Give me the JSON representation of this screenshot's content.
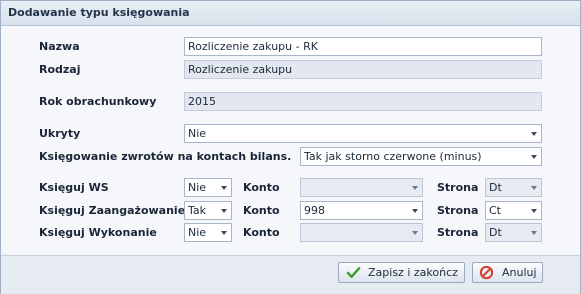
{
  "window": {
    "title": "Dodawanie typu księgowania"
  },
  "form": {
    "nazwa": {
      "label": "Nazwa",
      "value": "Rozliczenie zakupu - RK"
    },
    "rodzaj": {
      "label": "Rodzaj",
      "value": "Rozliczenie zakupu"
    },
    "rok": {
      "label": "Rok obrachunkowy",
      "value": "2015"
    },
    "ukryty": {
      "label": "Ukryty",
      "value": "Nie"
    },
    "zwroty": {
      "label": "Księgowanie zwrotów na kontach bilans.",
      "value": "Tak jak storno czerwone (minus)"
    },
    "rows": [
      {
        "label": "Księguj WS",
        "toggle": "Nie",
        "konto_label": "Konto",
        "konto": "",
        "strona_label": "Strona",
        "strona": "Dt"
      },
      {
        "label": "Księguj Zaangażowanie",
        "toggle": "Tak",
        "konto_label": "Konto",
        "konto": "998",
        "strona_label": "Strona",
        "strona": "Ct"
      },
      {
        "label": "Księguj Wykonanie",
        "toggle": "Nie",
        "konto_label": "Konto",
        "konto": "",
        "strona_label": "Strona",
        "strona": "Dt"
      }
    ]
  },
  "buttons": {
    "save": {
      "label": "Zapisz i zakończ",
      "icon": "check-icon"
    },
    "cancel": {
      "label": "Anuluj",
      "icon": "cancel-icon"
    }
  },
  "colors": {
    "accent": "#3a5578",
    "save_icon": "#3f9f2b",
    "cancel_icon": "#d2412a"
  }
}
